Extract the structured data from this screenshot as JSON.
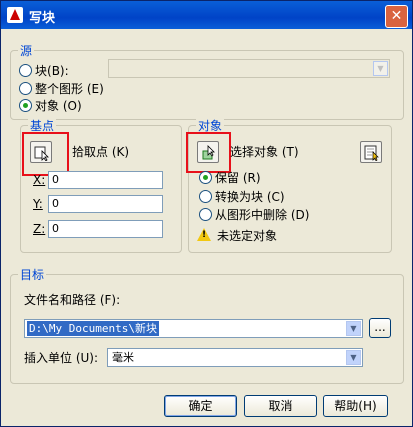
{
  "window": {
    "title": "写块",
    "close_glyph": "✕"
  },
  "source": {
    "label": "源",
    "options": [
      {
        "label": "块",
        "hotkey": "(B)",
        "selected": false
      },
      {
        "label": "整个图形",
        "hotkey": "(E)",
        "selected": false
      },
      {
        "label": "对象",
        "hotkey": "(O)",
        "selected": true
      }
    ],
    "block_combo_value": ""
  },
  "base_point": {
    "label": "基点",
    "pick_label": "拾取点",
    "pick_hotkey": "(K)",
    "x_label": "X:",
    "x_value": "0",
    "y_label": "Y:",
    "y_value": "0",
    "z_label": "Z:",
    "z_value": "0"
  },
  "objects": {
    "label": "对象",
    "select_label": "选择对象",
    "select_hotkey": "(T)",
    "options": [
      {
        "label": "保留",
        "hotkey": "(R)",
        "selected": true
      },
      {
        "label": "转换为块",
        "hotkey": "(C)",
        "selected": false
      },
      {
        "label": "从图形中删除",
        "hotkey": "(D)",
        "selected": false
      }
    ],
    "warning_text": "未选定对象"
  },
  "target": {
    "label": "目标",
    "filename_label": "文件名和路径",
    "filename_hotkey": "(F):",
    "filename_value": "D:\\My Documents\\新块",
    "browse_label": "...",
    "units_label": "插入单位",
    "units_hotkey": "(U):",
    "units_value": "毫米"
  },
  "buttons": {
    "ok": "确定",
    "cancel": "取消",
    "help": "帮助(H)"
  },
  "colors": {
    "title_bar": "#0a5fd8",
    "group_label": "#0046d5",
    "highlight_box": "#e8101a"
  }
}
